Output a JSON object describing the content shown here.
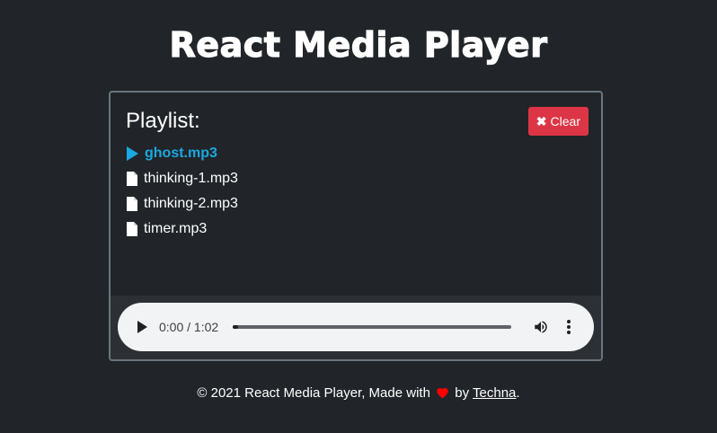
{
  "app": {
    "title": "React Media Player"
  },
  "playlist": {
    "heading": "Playlist:",
    "clear_label": "Clear",
    "clear_icon": "x-icon",
    "tracks": [
      {
        "name": "ghost.mp3",
        "icon": "play-icon",
        "active": true
      },
      {
        "name": "thinking-1.mp3",
        "icon": "file-icon",
        "active": false
      },
      {
        "name": "thinking-2.mp3",
        "icon": "file-icon",
        "active": false
      },
      {
        "name": "timer.mp3",
        "icon": "file-icon",
        "active": false
      }
    ]
  },
  "player": {
    "time": "0:00 / 1:02",
    "progress": 0.02,
    "play_icon": "play-icon",
    "volume_icon": "volume-icon",
    "menu_icon": "more-vert-icon"
  },
  "footer": {
    "prefix": "© 2021 React Media Player, Made with",
    "by": "by",
    "author": "Techna",
    "suffix": "."
  },
  "colors": {
    "background": "#212529",
    "accent": "#1aa8e0",
    "danger": "#dc3545",
    "heart": "#ff0000",
    "card_border": "#6c757d"
  }
}
